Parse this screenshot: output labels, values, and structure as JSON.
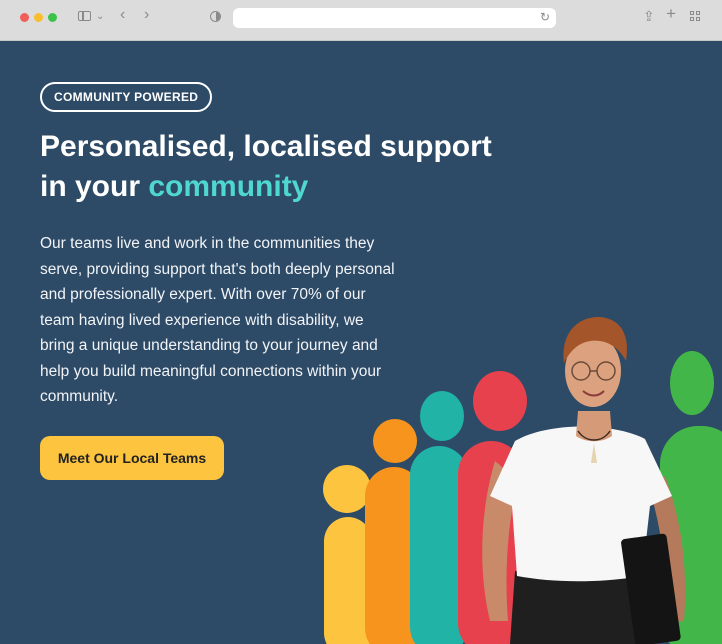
{
  "browser": {
    "icons": [
      "sidebar-icon",
      "chevron-down-icon",
      "back-icon",
      "forward-icon",
      "shield-icon",
      "reload-icon",
      "share-icon",
      "new-tab-icon",
      "tab-overview-icon"
    ]
  },
  "hero": {
    "badge": "COMMUNITY POWERED",
    "heading_prefix": "Personalised, localised support in your ",
    "heading_accent": "community",
    "body": "Our teams live and work in the communities they serve, providing support that's both deeply personal and professionally expert. With over 70% of our team having lived experience with disability, we bring a unique understanding to your journey and help you build meaningful connections within your community.",
    "cta_label": "Meet Our Local Teams"
  },
  "colors": {
    "background": "#2d4a66",
    "accent": "#4fd8cf",
    "button": "#fcc43f",
    "figure_yellow": "#fcc43f",
    "figure_orange": "#f7941d",
    "figure_teal": "#20b3a6",
    "figure_red": "#e8414e",
    "figure_green": "#43b649"
  }
}
